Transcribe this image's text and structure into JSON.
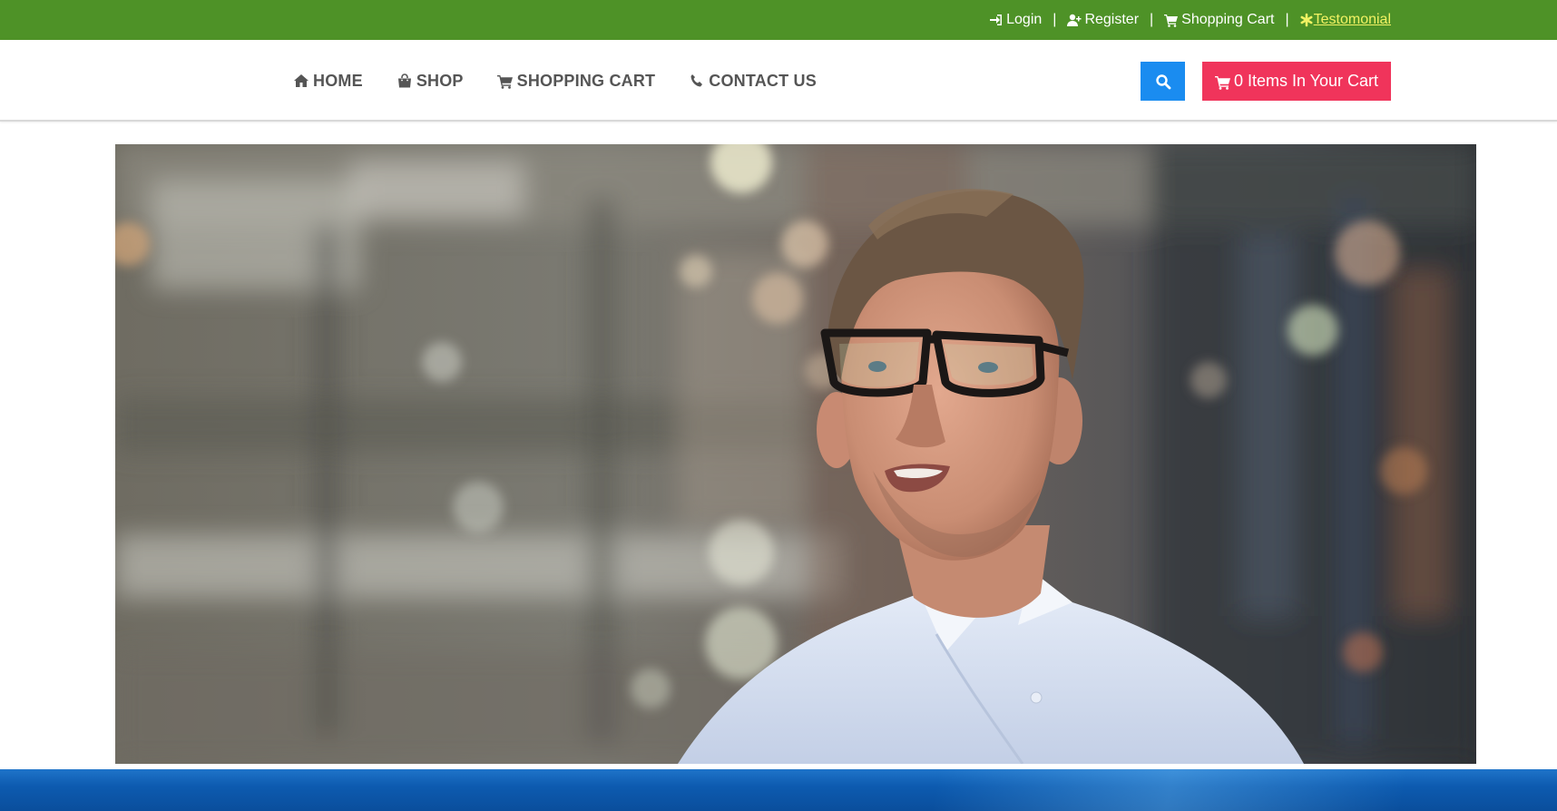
{
  "topbar": {
    "background": "#4e9227",
    "links": [
      {
        "label": "Login",
        "icon": "sign-in-icon"
      },
      {
        "label": "Register",
        "icon": "user-plus-icon"
      },
      {
        "label": "Shopping Cart",
        "icon": "cart-icon"
      },
      {
        "label": "Testomonial",
        "icon": "asterisk-icon",
        "highlight_color": "#f2f263"
      }
    ],
    "separator": "|"
  },
  "nav": {
    "items": [
      {
        "label": "HOME",
        "icon": "home-icon"
      },
      {
        "label": "SHOP",
        "icon": "shopping-bag-icon"
      },
      {
        "label": "SHOPPING CART",
        "icon": "cart-icon"
      },
      {
        "label": "CONTACT US",
        "icon": "phone-icon"
      }
    ],
    "search_button_icon": "search-icon",
    "search_button_color": "#1a8cf0",
    "cart_button": {
      "label": "0 Items In Your Cart",
      "icon": "cart-icon",
      "color": "#f0345b"
    }
  },
  "hero": {
    "content": "video-frame-man-with-glasses"
  },
  "footer_band": {
    "color": "#0d5bb0"
  }
}
